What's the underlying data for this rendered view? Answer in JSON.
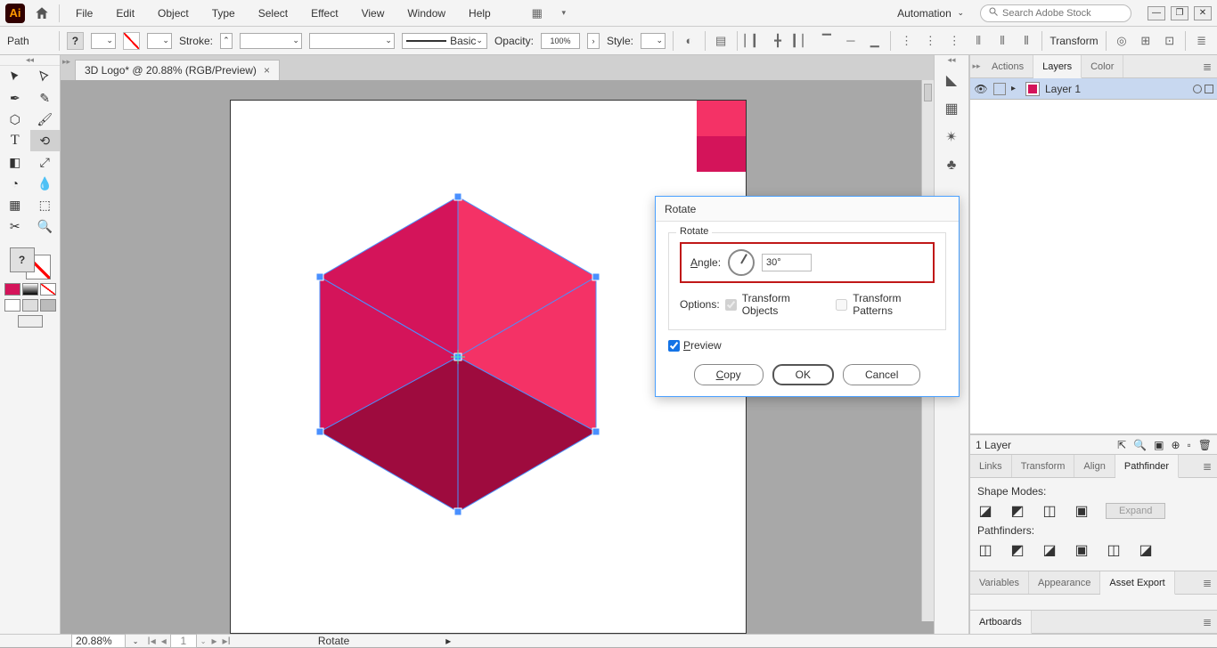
{
  "menu": {
    "items": [
      "File",
      "Edit",
      "Object",
      "Type",
      "Select",
      "Effect",
      "View",
      "Window",
      "Help"
    ],
    "workspace": "Automation"
  },
  "search": {
    "placeholder": "Search Adobe Stock"
  },
  "ctrl": {
    "label": "Path",
    "stroke": "Stroke:",
    "lineStyle": "Basic",
    "opacity_label": "Opacity:",
    "opacity": "100%",
    "style": "Style:",
    "transform": "Transform"
  },
  "doc": {
    "tab": "3D Logo* @ 20.88% (RGB/Preview)"
  },
  "layers": {
    "tabs": [
      "Actions",
      "Layers",
      "Color"
    ],
    "row": "Layer 1",
    "footer": "1 Layer"
  },
  "panels2": {
    "tabs": [
      "Links",
      "Transform",
      "Align",
      "Pathfinder"
    ],
    "shapeModes": "Shape Modes:",
    "pathfinders": "Pathfinders:",
    "expand": "Expand"
  },
  "panels3": {
    "tabs": [
      "Variables",
      "Appearance",
      "Asset Export"
    ]
  },
  "panels4": {
    "tabs": [
      "Artboards"
    ]
  },
  "status": {
    "zoom": "20.88%",
    "page": "1",
    "tool": "Rotate"
  },
  "dialog": {
    "title": "Rotate",
    "legend": "Rotate",
    "angle_label": "Angle:",
    "angle": "30°",
    "options": "Options:",
    "transformObjects": "Transform Objects",
    "transformPatterns": "Transform Patterns",
    "preview": "Preview",
    "copy": "Copy",
    "ok": "OK",
    "cancel": "Cancel"
  },
  "swatch_question": "?"
}
